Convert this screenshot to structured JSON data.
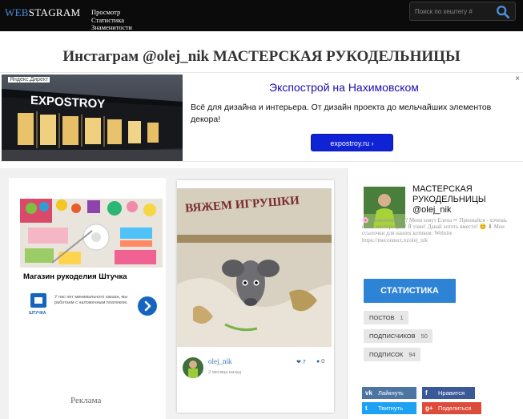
{
  "header": {
    "logo_part1": "WEB",
    "logo_part2": "STAGRAM",
    "nav": [
      "Просмотр",
      "Статистика",
      "Знаменитости"
    ],
    "search_placeholder": "Поиск по хештегу #"
  },
  "page_title": "Инстаграм @olej_nik МАСТЕРСКАЯ РУКОДЕЛЬНИЦЫ",
  "banner": {
    "tag": "Яндекс.Директ",
    "brand": "EXPOSTROY",
    "headline": "Экспострой на Нахимовском",
    "text": "Всё для дизайна и интерьера. От дизайн проекта до мельчайших элементов декора!",
    "cta": "expostroy.ru ›",
    "close": "×"
  },
  "ad_card": {
    "shop": "Магазин рукоделия Штучка",
    "logo_text": "ШТУЧКА",
    "description": "У нас нет минимального заказа, мы работаем с наложенным платежом.",
    "label": "Реклама"
  },
  "post": {
    "user": "olej_nik",
    "time": "2 месяца назад",
    "likes": "7",
    "comments": "0",
    "photo_text": "ВЯЖЕМ ИГРУШКИ"
  },
  "profile": {
    "name_line1": "МАСТЕРСКАЯ",
    "name_line2": "РУКОДЕЛЬНИЦЫ",
    "handle": "@olej_nik",
    "bio": "🌸 Познакомимся? Меня зовут Елена ✂ Признайся - хочешь свою мастерскую? Я тоже! Давай хотеть вместе! 😊 ⬇ Мои ссылочки для наших котиков: Website https://meconnect.ru/olej_nik",
    "stats_button": "СТАТИСТИКА",
    "posts_label": "ПОСТОВ",
    "posts_count": "1",
    "followers_label": "ПОДПИСЧИКОВ",
    "followers_count": "50",
    "following_label": "ПОДПИСОК",
    "following_count": "94"
  },
  "share": {
    "vk": "Лайкнуть",
    "fb": "Нравится",
    "tw": "Твитнуть",
    "gp": "Поделиться"
  },
  "colors": {
    "accent": "#2d83d6",
    "topbar": "#0b0b0b",
    "vk": "#4c75a3",
    "fb": "#3b5998",
    "tw": "#1da1f2",
    "gp": "#dd4b39"
  }
}
